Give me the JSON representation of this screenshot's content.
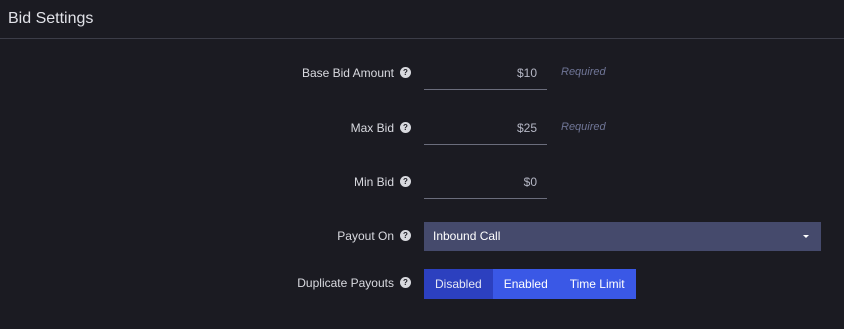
{
  "header": {
    "title": "Bid Settings"
  },
  "fields": {
    "base_bid": {
      "label": "Base Bid Amount",
      "value": "$10",
      "hint": "Required"
    },
    "max_bid": {
      "label": "Max Bid",
      "value": "$25",
      "hint": "Required"
    },
    "min_bid": {
      "label": "Min Bid",
      "value": "$0"
    },
    "payout_on": {
      "label": "Payout On",
      "selected": "Inbound Call"
    },
    "duplicate_payouts": {
      "label": "Duplicate Payouts",
      "options": [
        "Disabled",
        "Enabled",
        "Time Limit"
      ],
      "selected": "Disabled"
    }
  },
  "icons": {
    "help": "question-circle-icon",
    "dropdown": "caret-down-icon"
  },
  "colors": {
    "background": "#1b1b22",
    "select_bg": "#454a6c",
    "button_bg": "#3a58e6",
    "button_active_bg": "#2c40bf",
    "hint_text": "#6f7596"
  }
}
